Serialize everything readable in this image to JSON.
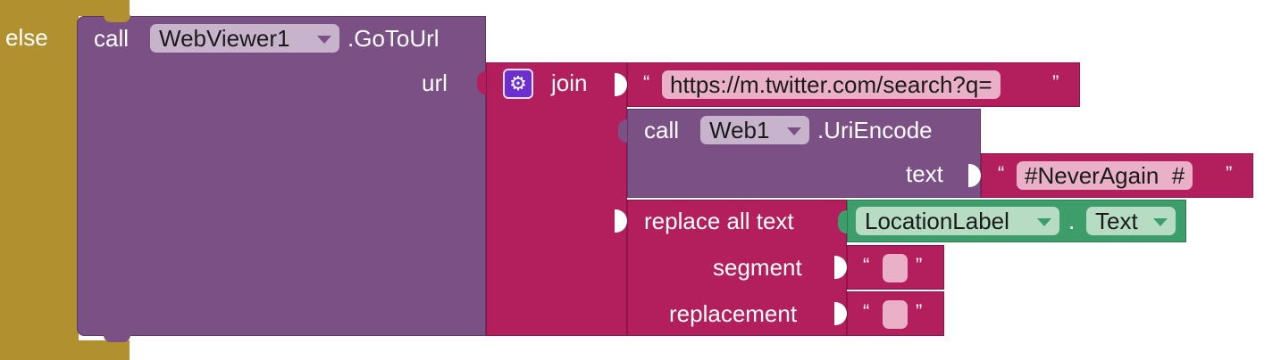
{
  "else_block": {
    "label": "else"
  },
  "goto_block": {
    "call_label": "call",
    "component": "WebViewer1",
    "method": ".GoToUrl",
    "param_label": "url"
  },
  "join_block": {
    "label": "join",
    "icon": "gear-icon"
  },
  "text_block_url": {
    "open_quote": "“",
    "value": "https://m.twitter.com/search?q=",
    "close_quote": "”"
  },
  "encode_block": {
    "call_label": "call",
    "component": "Web1",
    "method": ".UriEncode",
    "param_label": "text"
  },
  "text_block_tag": {
    "open_quote": "“",
    "value": "#NeverAgain  #",
    "close_quote": "”"
  },
  "replace_block": {
    "label": "replace all text",
    "segment_label": "segment",
    "replacement_label": "replacement"
  },
  "getter_block": {
    "component": "LocationLabel",
    "dot": ".",
    "property": "Text"
  },
  "text_block_segment": {
    "open_quote": "“",
    "value": " ",
    "close_quote": "”"
  },
  "text_block_replacement": {
    "open_quote": "“",
    "value": " ",
    "close_quote": "”"
  },
  "colors": {
    "control": "#b0902f",
    "component_method": "#7b5085",
    "text": "#b21f5c",
    "getter": "#3e9e6b"
  }
}
